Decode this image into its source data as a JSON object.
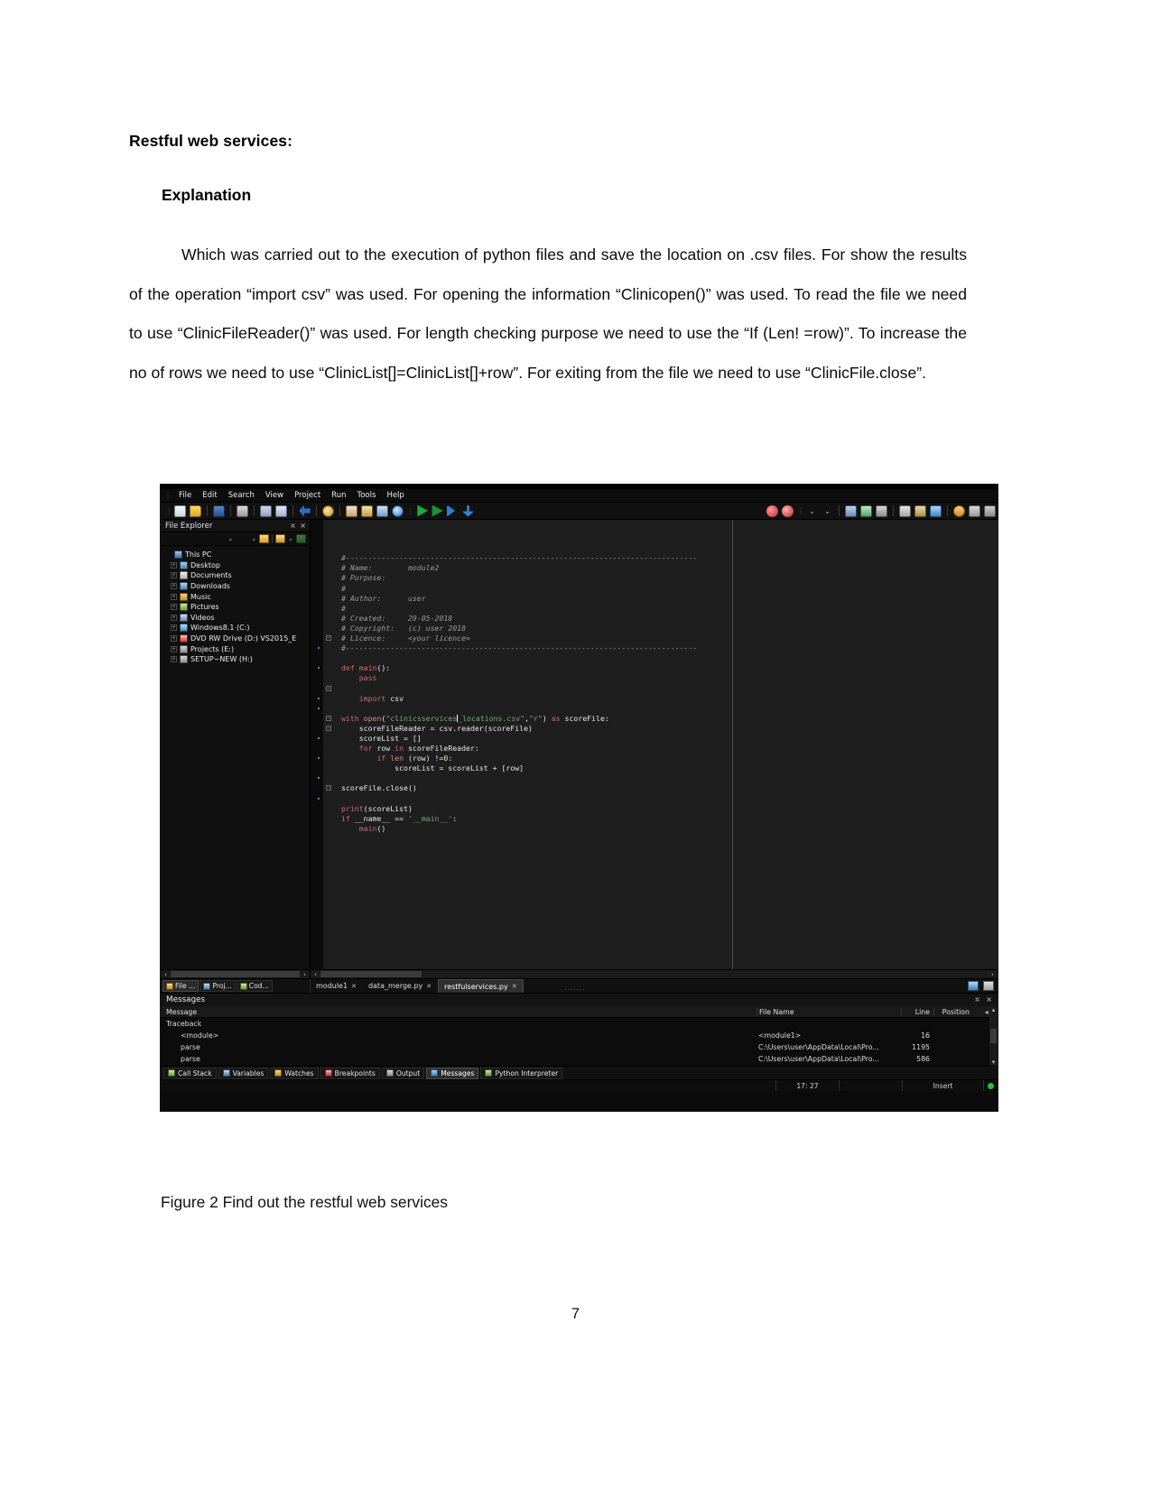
{
  "document": {
    "heading": "Restful web services:",
    "subheading": "Explanation",
    "paragraph": "Which was carried out to the execution of python files and save the location on .csv files. For show the results of the operation “import csv” was used. For opening the information “Clinicopen()”  was used. To read the file we need to use “ClinicFileReader()” was used. For length checking purpose we need to use the “If (Len! =row)”. To increase the no of rows we need to use “ClinicList[]=ClinicList[]+row”. For exiting from the file we need to use “ClinicFile.close”.",
    "caption": "Figure 2 Find out the restful web services",
    "page_number": "7"
  },
  "ide": {
    "menu": {
      "items": [
        "File",
        "Edit",
        "Search",
        "View",
        "Project",
        "Run",
        "Tools",
        "Help"
      ]
    },
    "toolbar": {
      "icons": [
        "new-file-icon",
        "open-file-icon",
        "save-icon",
        "print-icon",
        "cut-icon",
        "copy-icon",
        "undo-icon",
        "find-icon",
        "replace-icon",
        "goto-icon",
        "bookmark-icon",
        "help-icon",
        "run-icon",
        "debug-icon",
        "step-over-icon",
        "step-into-icon",
        "breakpoint-icon",
        "clear-breakpoints-icon",
        "indent-icon",
        "unindent-icon",
        "comment-icon",
        "list-icon",
        "book-icon",
        "mark-icon",
        "sync-icon",
        "grid-icon",
        "panel-icon"
      ]
    },
    "explorer": {
      "title": "File Explorer",
      "pin_glyph": "⯏",
      "close_glyph": "×",
      "tree": [
        {
          "label": "This PC",
          "icon": "this-pc-icon",
          "level": 0,
          "expander": ""
        },
        {
          "label": "Desktop",
          "icon": "desktop-icon",
          "level": 1,
          "expander": "+"
        },
        {
          "label": "Documents",
          "icon": "documents-icon",
          "level": 1,
          "expander": "+"
        },
        {
          "label": "Downloads",
          "icon": "downloads-icon",
          "level": 1,
          "expander": "+"
        },
        {
          "label": "Music",
          "icon": "music-icon",
          "level": 1,
          "expander": "+"
        },
        {
          "label": "Pictures",
          "icon": "pictures-icon",
          "level": 1,
          "expander": "+"
        },
        {
          "label": "Videos",
          "icon": "videos-icon",
          "level": 1,
          "expander": "+"
        },
        {
          "label": "Windows8.1 (C:)",
          "icon": "harddisk-icon",
          "level": 1,
          "expander": "+"
        },
        {
          "label": "DVD RW Drive (D:) VS2015_E",
          "icon": "dvd-icon",
          "level": 1,
          "expander": "+"
        },
        {
          "label": "Projects (E:)",
          "icon": "drive-icon",
          "level": 1,
          "expander": "+"
        },
        {
          "label": "SETUP~NEW (H:)",
          "icon": "drive-icon",
          "level": 1,
          "expander": "+"
        }
      ],
      "panel_tabs": [
        {
          "label": "File ...",
          "icon": "file-explorer-tab-icon",
          "active": true
        },
        {
          "label": "Proj...",
          "icon": "project-explorer-tab-icon",
          "active": false
        },
        {
          "label": "Cod...",
          "icon": "code-explorer-tab-icon",
          "active": false
        }
      ]
    },
    "editor": {
      "tabs": [
        {
          "label": "module1",
          "active": false
        },
        {
          "label": "data_merge.py",
          "active": false
        },
        {
          "label": "restfulservices.py",
          "active": true
        }
      ],
      "code_lines": [
        {
          "t": "comment",
          "text": "#-------------------------------------------------------------------------------"
        },
        {
          "t": "comment",
          "text": "# Name:        module2"
        },
        {
          "t": "comment",
          "text": "# Purpose:"
        },
        {
          "t": "comment",
          "text": "#"
        },
        {
          "t": "comment",
          "text": "# Author:      user"
        },
        {
          "t": "comment",
          "text": "#"
        },
        {
          "t": "comment",
          "text": "# Created:     29-05-2018"
        },
        {
          "t": "comment",
          "text": "# Copyright:   (c) user 2018"
        },
        {
          "t": "comment",
          "text": "# Licence:     <your licence>"
        },
        {
          "t": "comment",
          "text": "#-------------------------------------------------------------------------------"
        },
        {
          "t": "blank",
          "text": ""
        },
        {
          "t": "code",
          "text": "def main():"
        },
        {
          "t": "code",
          "text": "    pass"
        },
        {
          "t": "blank",
          "text": ""
        },
        {
          "t": "code",
          "text": "    import csv"
        },
        {
          "t": "blank",
          "text": ""
        },
        {
          "t": "code",
          "text": "with open(\"clinicsservices_locations.csv\",\"r\") as scoreFile:"
        },
        {
          "t": "code",
          "text": "    scoreFileReader = csv.reader(scoreFile)"
        },
        {
          "t": "code",
          "text": "    scoreList = []"
        },
        {
          "t": "code",
          "text": "    for row in scoreFileReader:"
        },
        {
          "t": "code",
          "text": "        if len (row) !=0:"
        },
        {
          "t": "code",
          "text": "            scoreList = scoreList + [row]"
        },
        {
          "t": "blank",
          "text": ""
        },
        {
          "t": "code",
          "text": "scoreFile.close()"
        },
        {
          "t": "blank",
          "text": ""
        },
        {
          "t": "code",
          "text": "print(scoreList)"
        },
        {
          "t": "code",
          "text": "if __name__ == '__main__':"
        },
        {
          "t": "code",
          "text": "    main()"
        }
      ]
    },
    "messages": {
      "title": "Messages",
      "columns": [
        "Message",
        "File Name",
        "Line",
        "Position"
      ],
      "rows": [
        {
          "message": "Traceback",
          "indent": false,
          "file": "",
          "line": "",
          "position": ""
        },
        {
          "message": "<module>",
          "indent": true,
          "file": "<module1>",
          "line": "16",
          "position": ""
        },
        {
          "message": "parse",
          "indent": true,
          "file": "C:\\Users\\user\\AppData\\Local\\Pro...",
          "line": "1195",
          "position": ""
        },
        {
          "message": "parse",
          "indent": true,
          "file": "C:\\Users\\user\\AppData\\Local\\Pro...",
          "line": "586",
          "position": ""
        }
      ]
    },
    "bottom_tabs": [
      {
        "label": "Call Stack",
        "icon": "call-stack-icon",
        "active": false
      },
      {
        "label": "Variables",
        "icon": "variables-icon",
        "active": false
      },
      {
        "label": "Watches",
        "icon": "watches-icon",
        "active": false
      },
      {
        "label": "Breakpoints",
        "icon": "breakpoints-icon",
        "active": false
      },
      {
        "label": "Output",
        "icon": "output-icon",
        "active": false
      },
      {
        "label": "Messages",
        "icon": "messages-icon",
        "active": true
      },
      {
        "label": "Python Interpreter",
        "icon": "python-interpreter-icon",
        "active": false
      }
    ],
    "status_bar": {
      "position": "17: 27",
      "mode": "Insert",
      "led_color": "#2bbf3a"
    }
  }
}
